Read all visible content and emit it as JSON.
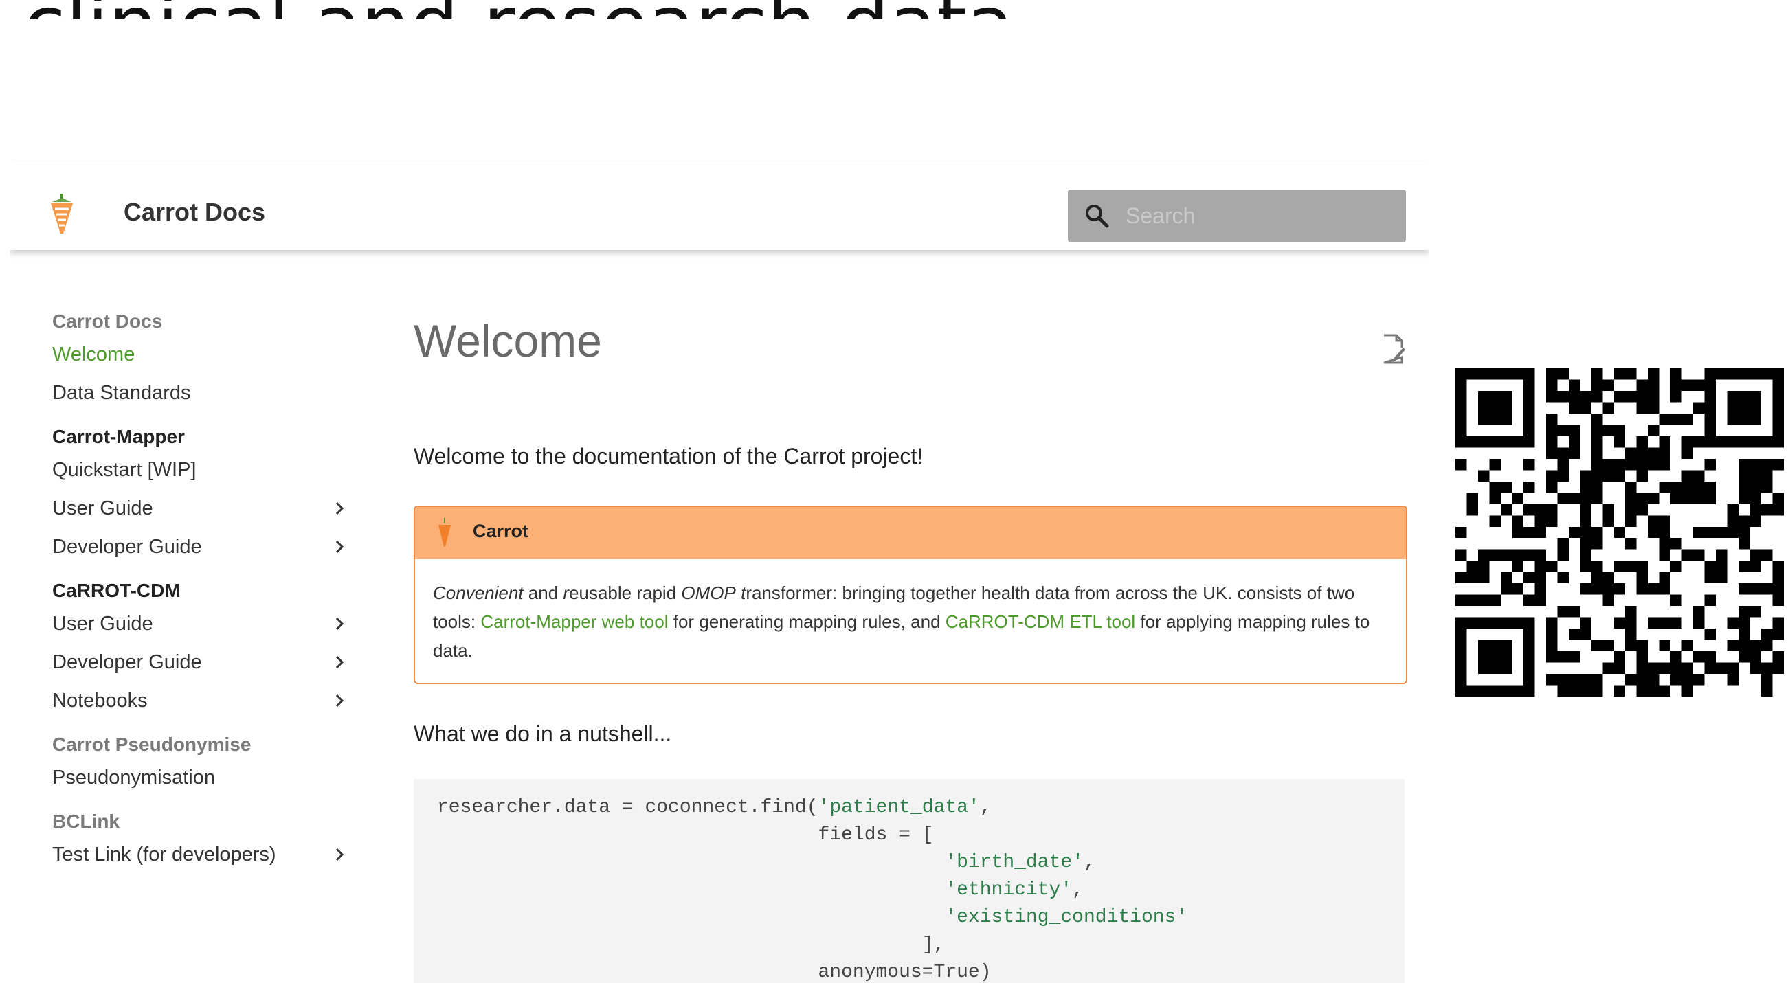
{
  "slide": {
    "title": "clinical and research data."
  },
  "header": {
    "site_title": "Carrot Docs",
    "search_placeholder": "Search"
  },
  "sidebar": {
    "sections": [
      {
        "heading": "Carrot Docs",
        "items": [
          {
            "label": "Welcome",
            "active": true,
            "expandable": false
          },
          {
            "label": "Data Standards",
            "active": false,
            "expandable": false
          }
        ]
      },
      {
        "heading": "Carrot-Mapper",
        "items": [
          {
            "label": "Quickstart [WIP]",
            "active": false,
            "expandable": false
          },
          {
            "label": "User Guide",
            "active": false,
            "expandable": true
          },
          {
            "label": "Developer Guide",
            "active": false,
            "expandable": true
          }
        ]
      },
      {
        "heading": "CaRROT-CDM",
        "items": [
          {
            "label": "User Guide",
            "active": false,
            "expandable": true
          },
          {
            "label": "Developer Guide",
            "active": false,
            "expandable": true
          },
          {
            "label": "Notebooks",
            "active": false,
            "expandable": true
          }
        ]
      },
      {
        "heading": "Carrot Pseudonymise",
        "items": [
          {
            "label": "Pseudonymisation",
            "active": false,
            "expandable": false
          }
        ]
      },
      {
        "heading": "BCLink",
        "items": [
          {
            "label": "Test Link (for developers)",
            "active": false,
            "expandable": true
          }
        ]
      }
    ]
  },
  "main": {
    "title": "Welcome",
    "intro": "Welcome to the documentation of the Carrot project!",
    "admonition": {
      "title": "Carrot",
      "body_part1": "Convenient and reusable rapid OMOP transformer: bringing together health data from across the UK. consists of two tools: ",
      "link1": "Carrot-Mapper web tool",
      "body_part2": " for generating mapping rules, and ",
      "link2": "CaRROT-CDM ETL tool",
      "body_part3": " for applying mapping rules to data."
    },
    "nutshell": "What we do in a nutshell...",
    "code_lines": [
      "researcher.data = coconnect.find('patient_data',",
      "                                 fields = [",
      "                                            'birth_date',",
      "                                            'ethnicity',",
      "                                            'existing_conditions'",
      "                                          ],",
      "                                 anonymous=True)"
    ]
  },
  "colors": {
    "accent_green": "#4e9a2c",
    "admonition_border": "#f08a3e",
    "admonition_header": "#fdb075",
    "search_bg": "#a8a8a8"
  },
  "icons": {
    "logo": "carrot-icon",
    "search": "search-icon",
    "edit": "edit-page-icon",
    "chevron": "chevron-right-icon",
    "qr": "qr-code"
  }
}
